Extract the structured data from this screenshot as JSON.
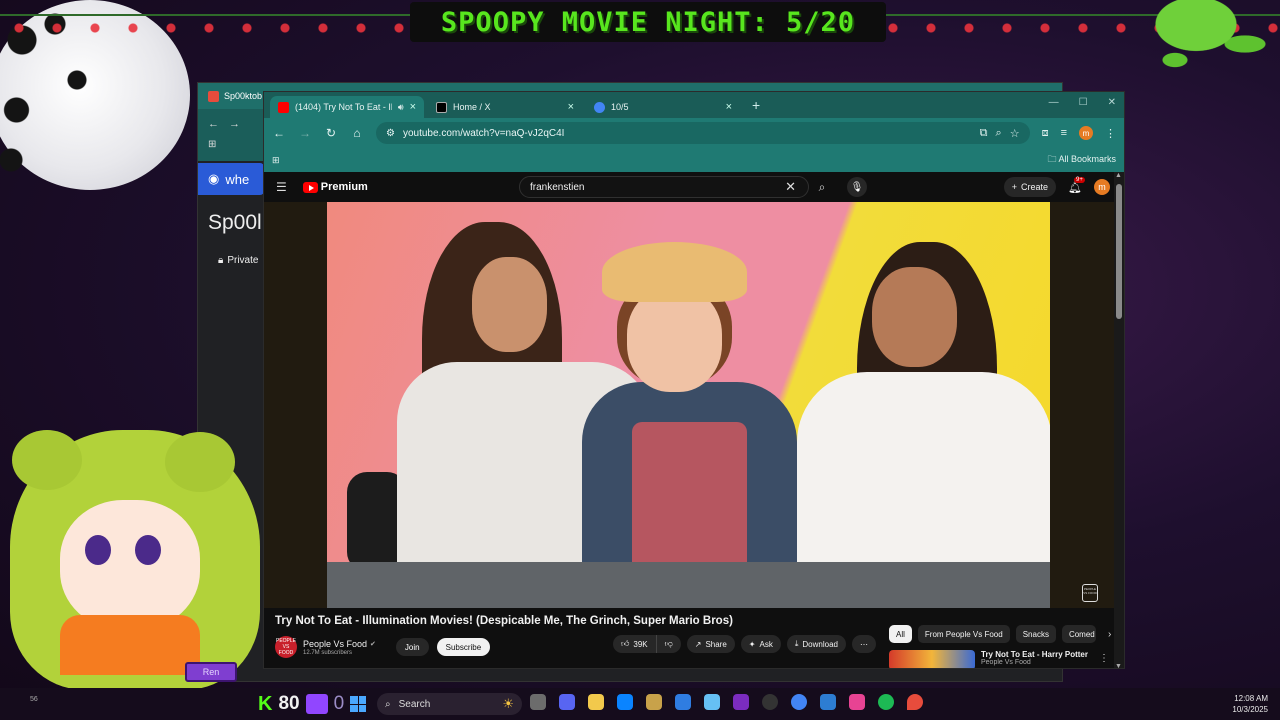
{
  "overlay": {
    "banner_text": "SPOOPY MOVIE NIGHT: 5/20",
    "avatar_tag": "Ren"
  },
  "back_window": {
    "tab_title": "Sp00ktob",
    "site_label": "whe",
    "page_title": "Sp00l",
    "private_label": "Private"
  },
  "browser": {
    "tabs": [
      {
        "title": "(1404) Try Not To Eat - Illum",
        "favicon_color": "#ff0000",
        "audio": true,
        "active": true
      },
      {
        "title": "Home / X",
        "favicon_color": "#000000",
        "audio": false,
        "active": false
      },
      {
        "title": "10/5",
        "favicon_color": "#4285f4",
        "audio": false,
        "active": false
      }
    ],
    "url": "youtube.com/watch?v=naQ-vJ2qC4I",
    "bookmarks_label": "All Bookmarks",
    "profile_initial": "m"
  },
  "youtube": {
    "logo_text": "Premium",
    "search_query": "frankenstien",
    "create_label": "Create",
    "notification_badge": "9+",
    "avatar_initial": "m",
    "video_title": "Try Not To Eat - Illumination Movies! (Despicable Me, The Grinch, Super Mario Bros)",
    "channel": {
      "avatar_text": "PEOPLE VS FOOD",
      "name": "People Vs Food",
      "subscribers": "12.7M subscribers",
      "join_label": "Join",
      "subscribe_label": "Subscribe"
    },
    "actions": {
      "likes": "39K",
      "share": "Share",
      "ask": "Ask",
      "download": "Download"
    },
    "chips": [
      "All",
      "From People Vs Food",
      "Snacks",
      "Comed"
    ],
    "recommendation": {
      "title": "Try Not To Eat - Harry Potter",
      "channel": "People Vs Food"
    },
    "watermark_text": "PEOPLE VS FOOD"
  },
  "taskbar": {
    "tray_text": "56",
    "kick_letter": "K",
    "viewer_count": "80",
    "zero_label": "0",
    "search_label": "Search",
    "time": "12:08 AM",
    "date": "10/3/2025",
    "app_colors": [
      "#6c6c6c",
      "#5865f2",
      "#f2c94c",
      "#0a84ff",
      "#c8a24a",
      "#2f7de1",
      "#66c0f4",
      "#7b2cbf",
      "#333333",
      "#4285f4",
      "#2d7dd2",
      "#e84393",
      "#1db954",
      "#e74c3c"
    ]
  }
}
